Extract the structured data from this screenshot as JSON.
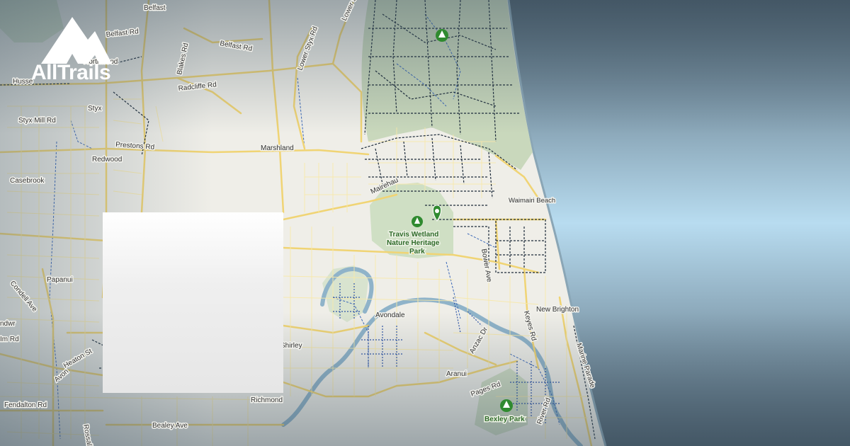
{
  "brand": {
    "name": "AllTrails",
    "logo_color": "#ffffff"
  },
  "map": {
    "water_color": "#aacbe0",
    "park_color": "#cfdcc3",
    "land_color": "#f1f0eb",
    "road_color": "#f2d97a",
    "trail_color": "#1d2b3a",
    "waterway_color": "#3a67b8",
    "marker_color": "#2f8a2f",
    "labels": {
      "belfast": "Belfast",
      "belfast_rd": "Belfast Rd",
      "northwood": "Northwood",
      "lower_styx_rd": "Lower Styx Rd",
      "lower_styx": "Lower S",
      "husse": "Husse",
      "blakes_rd": "Blakes Rd",
      "radcliffe_rd": "Radcliffe Rd",
      "styx": "Styx",
      "styx_mill_rd": "Styx Mill Rd",
      "prestons_rd": "Prestons Rd",
      "marshland": "Marshland",
      "redwood": "Redwood",
      "casebrook": "Casebrook",
      "papanui": "Papanui",
      "condell_ave": "Condell Ave",
      "harewood": "ndwr",
      "elm_rd": "Im Rd",
      "heaton_st": "Heaton St",
      "avon": "Avon",
      "fendalton_rd": "Fendalton Rd",
      "rossall_st": "Rossall St",
      "bealey_ave": "Bealey Ave",
      "richmond": "Richmond",
      "shirley": "Shirley",
      "avondale": "Avondale",
      "aranui": "Aranui",
      "pages_rd": "Pages Rd",
      "anzac_dr": "Anzac Dr",
      "bexley_park": "Bexley Park",
      "waimairi_beach": "Waimairi Beach",
      "new_brighton": "New Brighton",
      "keyes_rd": "Keyes Rd",
      "marine_parade": "Marine Parade",
      "bower_ave": "Bower Ave",
      "mairehau": "Mairehau",
      "travis_line1": "Travis Wetland",
      "travis_line2": "Nature Heritage",
      "travis_line3": "Park",
      "river_rd": "River Rd"
    }
  }
}
